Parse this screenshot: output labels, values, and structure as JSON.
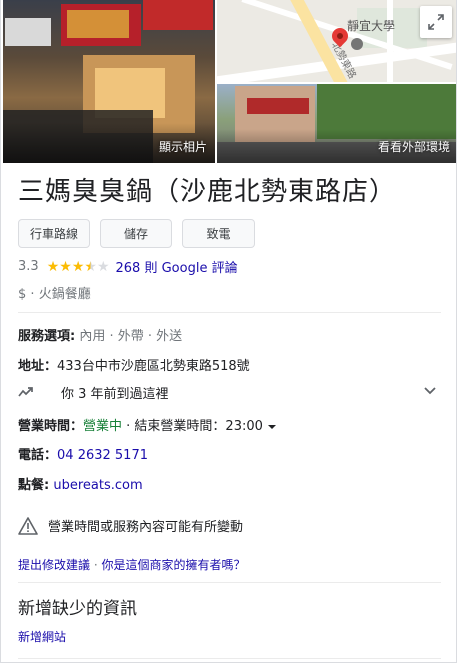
{
  "photos": {
    "main_label": "顯示相片",
    "street_label": "看看外部環境",
    "map_place": "靜宜大學",
    "map_road": "北勢東路"
  },
  "business": {
    "name": "三媽臭臭鍋（沙鹿北勢東路店）"
  },
  "actions": {
    "directions": "行車路線",
    "save": "儲存",
    "call": "致電"
  },
  "rating": {
    "score": "3.3",
    "stars_value": 3.3,
    "reviews_count": "268",
    "reviews_unit": "則 Google 評論"
  },
  "category": {
    "price": "$",
    "separator": "·",
    "type": "火鍋餐廳"
  },
  "details": {
    "service_label": "服務選項:",
    "service_values": " 內用 · 外帶 · 外送",
    "address_label": "地址：",
    "address_value": "433台中市沙鹿區北勢東路518號",
    "history_text": "你 3 年前到過這裡",
    "hours_label": "營業時間：",
    "hours_open": "營業中",
    "hours_close": " · 結束營業時間：23:00",
    "phone_label": "電話：",
    "phone_value": "04 2632 5171",
    "order_label": "點餐:",
    "order_value": "ubereats.com"
  },
  "notice": {
    "warning": "營業時間或服務內容可能有所變動"
  },
  "suggest": {
    "edit": "提出修改建議",
    "sep": " · ",
    "owner": "你是這個商家的擁有者嗎？"
  },
  "missing": {
    "heading": "新增缺少的資訊",
    "add_website": "新增網站"
  },
  "colors": {
    "star": "#fbbc04",
    "link": "#1a0dab",
    "open_green": "#188038",
    "pin_red": "#e53935"
  }
}
